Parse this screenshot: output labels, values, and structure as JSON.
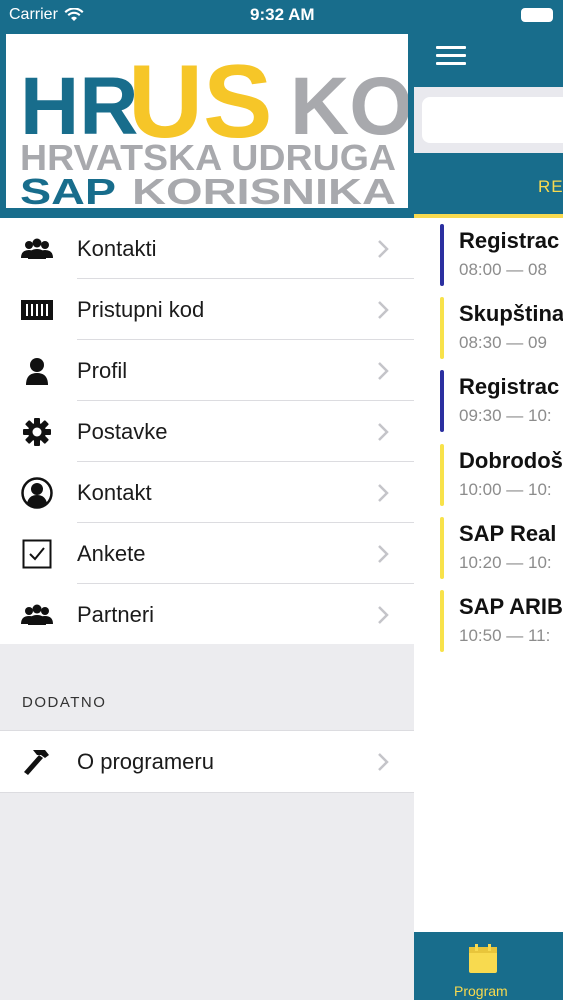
{
  "status": {
    "carrier": "Carrier",
    "time": "9:32 AM"
  },
  "logo": {
    "part_hr": "HR",
    "part_us": "US",
    "part_ko": "KO",
    "line2": "HRVATSKA UDRUGA",
    "line3_a": "SAP",
    "line3_b": "KORISNIKA"
  },
  "menu": {
    "items": [
      {
        "label": "Kontakti",
        "icon": "people-icon"
      },
      {
        "label": "Pristupni kod",
        "icon": "barcode-icon"
      },
      {
        "label": "Profil",
        "icon": "person-icon"
      },
      {
        "label": "Postavke",
        "icon": "gear-icon"
      },
      {
        "label": "Kontakt",
        "icon": "user-circle-icon"
      },
      {
        "label": "Ankete",
        "icon": "checkbox-icon"
      },
      {
        "label": "Partneri",
        "icon": "people-icon"
      }
    ]
  },
  "extra": {
    "section_title": "DODATNO",
    "items": [
      {
        "label": "O programeru",
        "icon": "hammer-icon"
      }
    ]
  },
  "main": {
    "tab_label": "RE",
    "events": [
      {
        "title": "Registrac",
        "time": "08:00 — 08",
        "color": "#2b2fa0"
      },
      {
        "title": "Skupština",
        "time": "08:30 — 09",
        "color": "#f8e24a"
      },
      {
        "title": "Registrac",
        "time": "09:30 — 10:",
        "color": "#2b2fa0"
      },
      {
        "title": "Dobrodoš",
        "time": "10:00 — 10:",
        "color": "#f8e24a"
      },
      {
        "title": "SAP Real",
        "time": "10:20 — 10:",
        "color": "#f8e24a"
      },
      {
        "title": "SAP ARIB",
        "time": "10:50 — 11:",
        "color": "#f8e24a"
      }
    ],
    "bottom_tab_label": "Program"
  },
  "colors": {
    "primary": "#186d8c",
    "accent": "#f8da4f",
    "logo_blue": "#186d8c",
    "logo_yellow": "#f6c628",
    "logo_gray": "#a8a9ad"
  }
}
